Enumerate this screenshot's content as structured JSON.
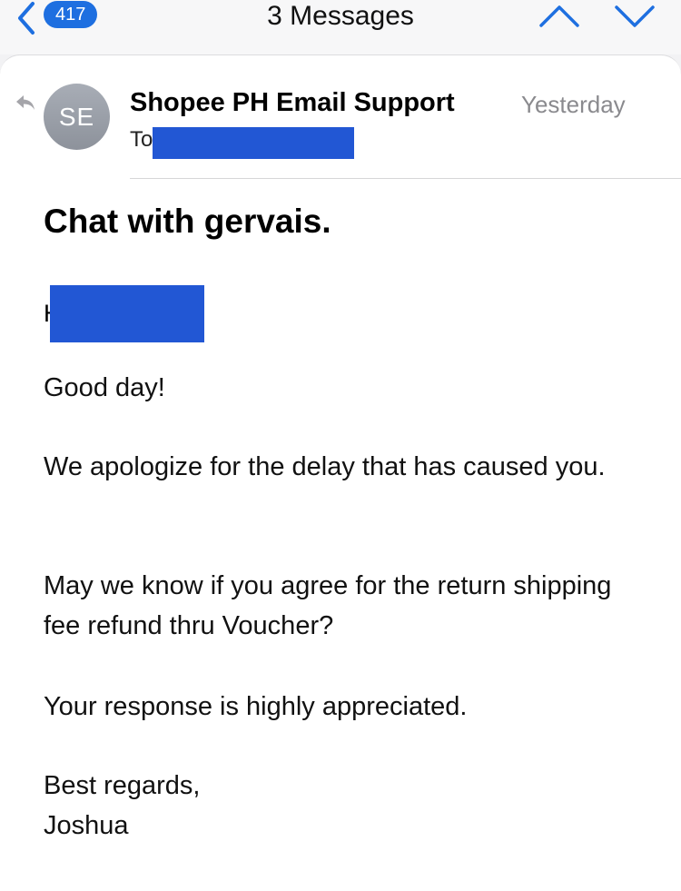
{
  "topbar": {
    "back_badge_count": "417",
    "title": "3 Messages",
    "up_icon": "chevron-up-icon",
    "down_icon": "chevron-down-icon"
  },
  "message": {
    "avatar_initials": "SE",
    "sender": "Shopee PH Email Support",
    "date": "Yesterday",
    "to_label": "To",
    "subject": "Chat with gervais.",
    "greeting_partial": "H",
    "body": [
      "Good day!",
      "We apologize for the delay that has caused you.",
      "May we know if you agree for the return shipping fee refund thru Voucher?",
      "Your response is highly appreciated.",
      "Best regards,",
      "Joshua"
    ]
  },
  "colors": {
    "accent": "#1e6fe0",
    "redaction": "#2257d4",
    "secondary_text": "#8a8a8e"
  }
}
